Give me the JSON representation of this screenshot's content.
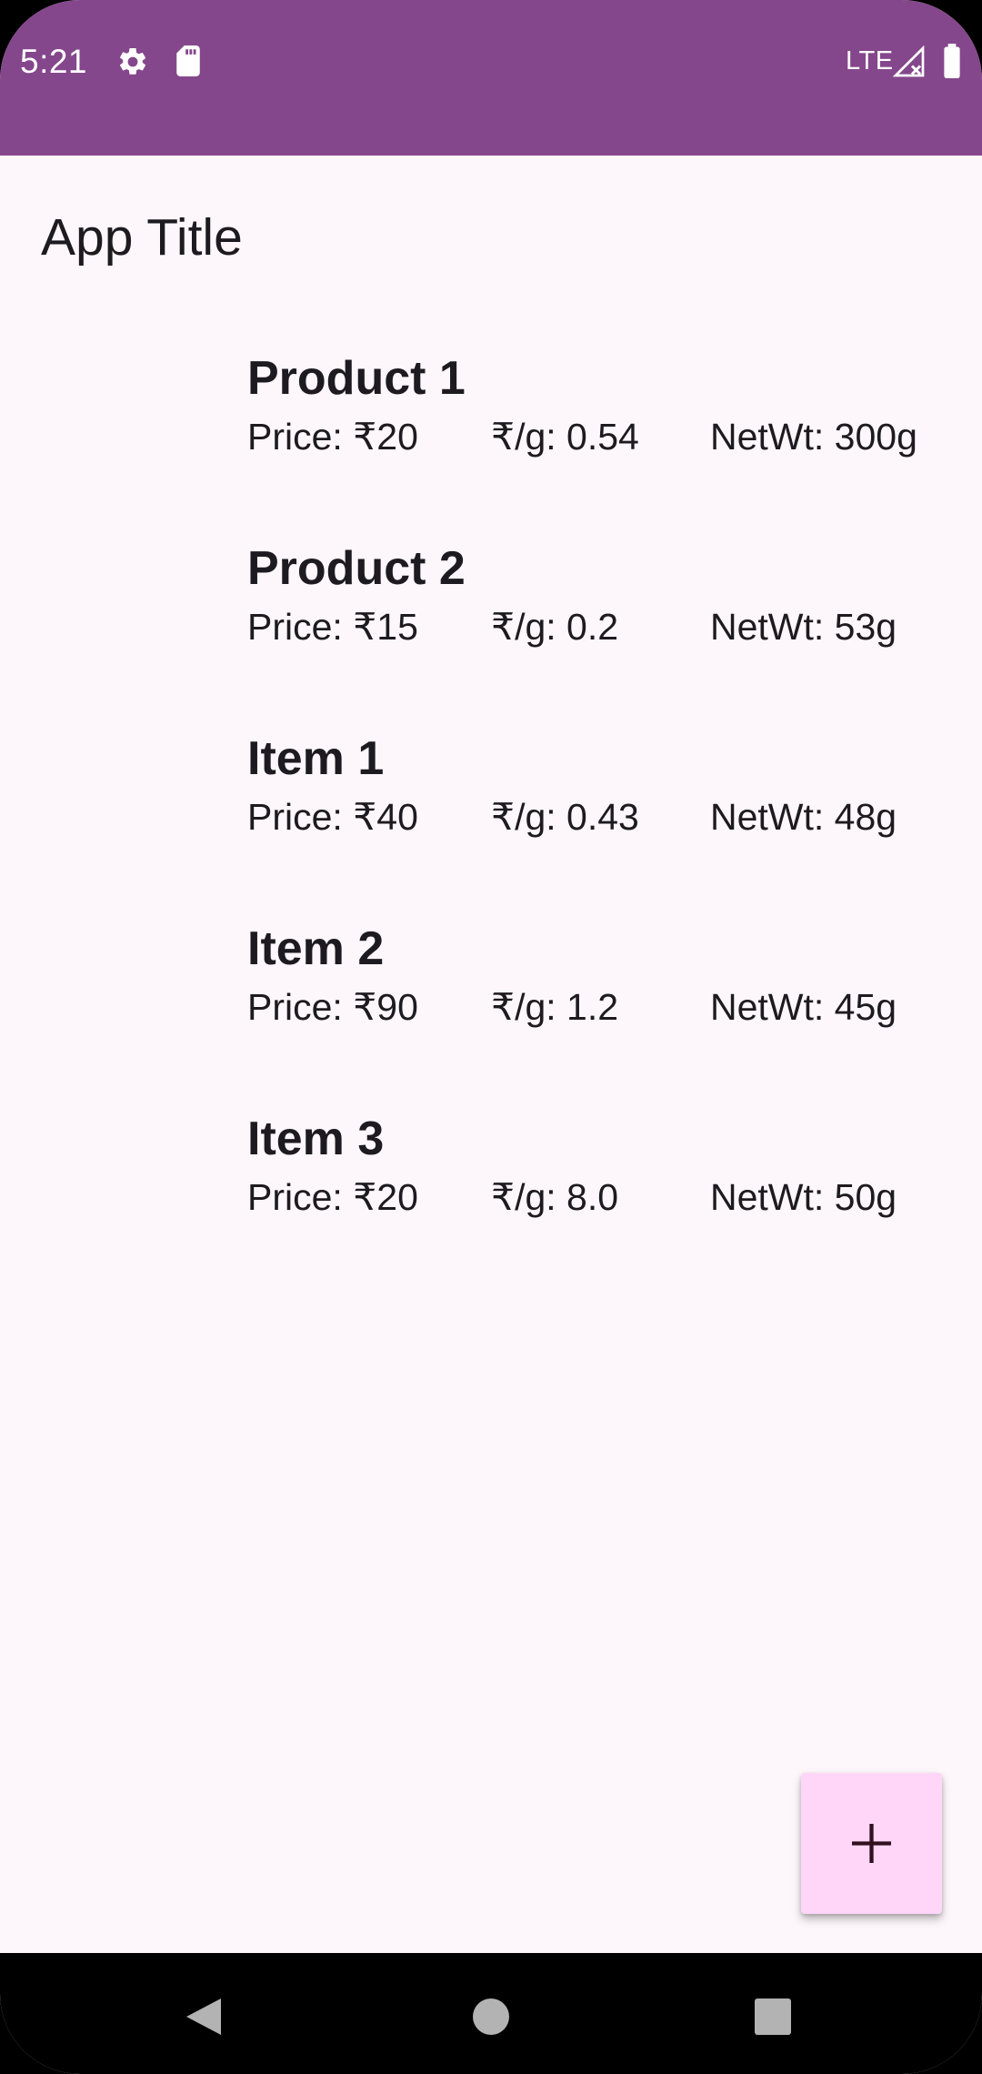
{
  "status_bar": {
    "time": "5:21",
    "network": "LTE",
    "icons": [
      "gear-icon",
      "sdcard-icon",
      "signal-icon",
      "battery-icon"
    ],
    "color": "#85478c"
  },
  "app": {
    "title": "App Title"
  },
  "items": [
    {
      "name": "Product 1",
      "price": "Price: ₹20",
      "per_gram": "₹/g: 0.54",
      "net_wt": "NetWt: 300g"
    },
    {
      "name": "Product 2",
      "price": "Price: ₹15",
      "per_gram": "₹/g: 0.2",
      "net_wt": "NetWt: 53g"
    },
    {
      "name": "Item 1",
      "price": "Price: ₹40",
      "per_gram": "₹/g: 0.43",
      "net_wt": "NetWt: 48g"
    },
    {
      "name": "Item 2",
      "price": "Price: ₹90",
      "per_gram": "₹/g: 1.2",
      "net_wt": "NetWt: 45g"
    },
    {
      "name": "Item 3",
      "price": "Price: ₹20",
      "per_gram": "₹/g: 8.0",
      "net_wt": "NetWt: 50g"
    }
  ],
  "fab": {
    "icon": "add-icon",
    "color": "#ffd6f8"
  },
  "navigation": {
    "buttons": [
      "back-icon",
      "home-icon",
      "recents-icon"
    ]
  }
}
